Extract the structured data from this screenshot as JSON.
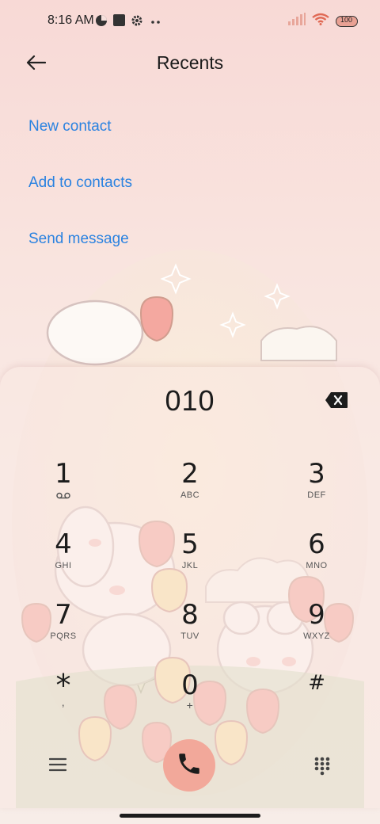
{
  "status": {
    "time": "8:16 AM",
    "battery": "100"
  },
  "header": {
    "title": "Recents"
  },
  "actions": [
    {
      "label": "New contact"
    },
    {
      "label": "Add to contacts"
    },
    {
      "label": "Send message"
    }
  ],
  "dialer": {
    "number": "010",
    "keys": [
      {
        "digit": "1",
        "letters": ""
      },
      {
        "digit": "2",
        "letters": "ABC"
      },
      {
        "digit": "3",
        "letters": "DEF"
      },
      {
        "digit": "4",
        "letters": "GHI"
      },
      {
        "digit": "5",
        "letters": "JKL"
      },
      {
        "digit": "6",
        "letters": "MNO"
      },
      {
        "digit": "7",
        "letters": "PQRS"
      },
      {
        "digit": "8",
        "letters": "TUV"
      },
      {
        "digit": "9",
        "letters": "WXYZ"
      },
      {
        "digit": "*",
        "letters": ","
      },
      {
        "digit": "0",
        "letters": "+"
      },
      {
        "digit": "#",
        "letters": ""
      }
    ]
  },
  "colors": {
    "accent": "#2a82e0",
    "call": "#f2a89a"
  }
}
